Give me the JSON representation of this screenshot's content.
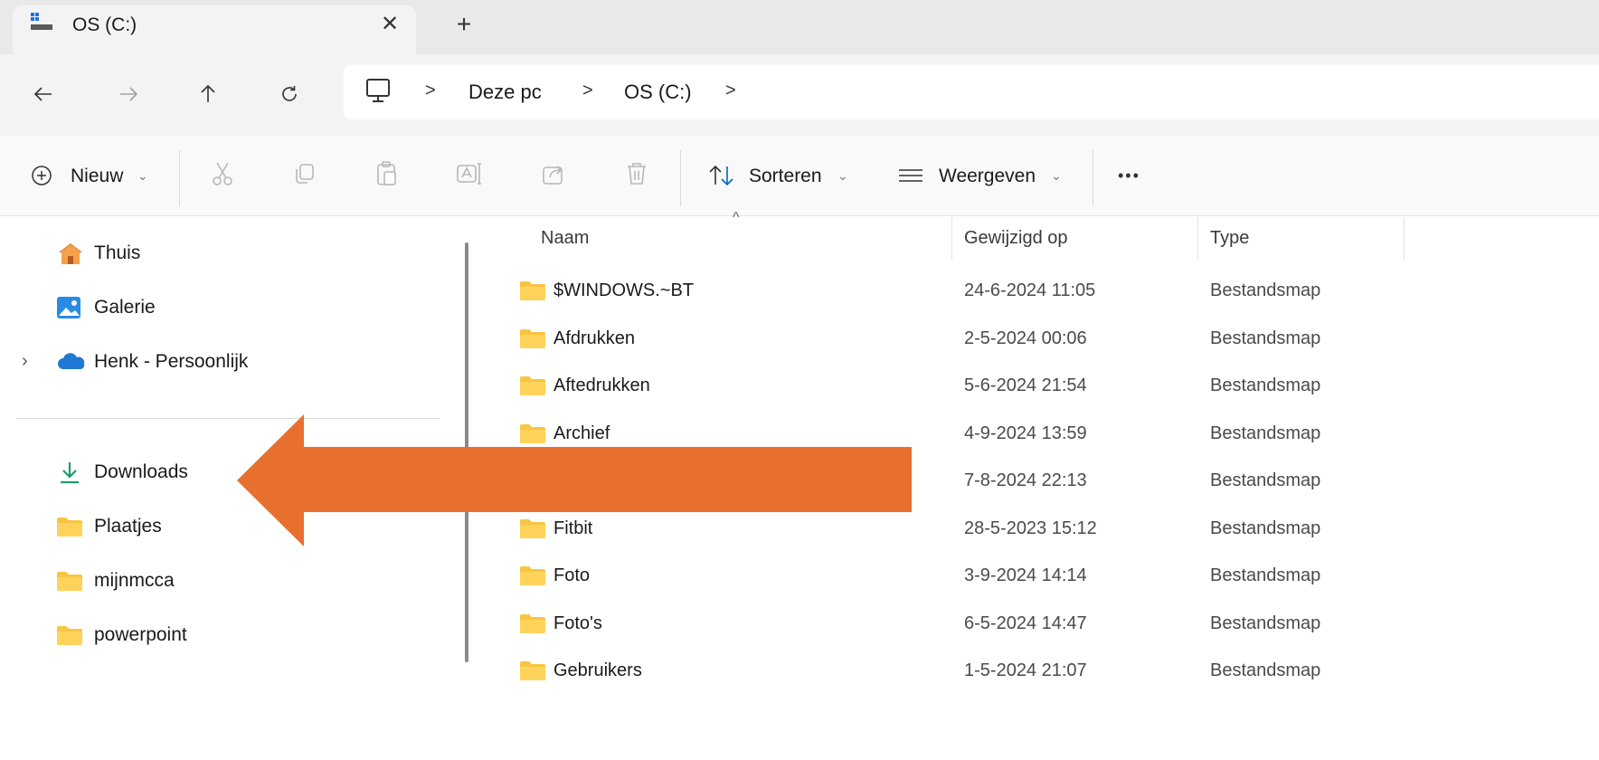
{
  "tab": {
    "title": "OS (C:)",
    "close_glyph": "✕",
    "add_glyph": "+"
  },
  "nav": {
    "back_icon": "arrow-left-icon",
    "forward_icon": "arrow-right-icon",
    "up_icon": "arrow-up-icon",
    "refresh_icon": "refresh-icon",
    "breadcrumb": [
      "Deze pc",
      "OS (C:)"
    ]
  },
  "toolbar": {
    "new_label": "Nieuw",
    "sort_label": "Sorteren",
    "view_label": "Weergeven",
    "more_glyph": "•••"
  },
  "sidebar": {
    "items_top": [
      {
        "label": "Thuis",
        "icon": "home-icon"
      },
      {
        "label": "Galerie",
        "icon": "gallery-icon"
      },
      {
        "label": "Henk - Persoonlijk",
        "icon": "onedrive-icon"
      }
    ],
    "items_quick": [
      {
        "label": "Downloads",
        "icon": "download-icon"
      },
      {
        "label": "Plaatjes",
        "icon": "folder-icon"
      },
      {
        "label": "mijnmcca",
        "icon": "folder-icon"
      },
      {
        "label": "powerpoint",
        "icon": "folder-icon"
      }
    ]
  },
  "filelist": {
    "columns": [
      "Naam",
      "Gewijzigd op",
      "Type"
    ],
    "rows": [
      {
        "name": "$WINDOWS.~BT",
        "date": "24-6-2024 11:05",
        "type": "Bestandsmap"
      },
      {
        "name": "Afdrukken",
        "date": "2-5-2024 00:06",
        "type": "Bestandsmap"
      },
      {
        "name": "Aftedrukken",
        "date": "5-6-2024 21:54",
        "type": "Bestandsmap"
      },
      {
        "name": "Archief",
        "date": "4-9-2024 13:59",
        "type": "Bestandsmap"
      },
      {
        "name": "",
        "date": "7-8-2024 22:13",
        "type": "Bestandsmap"
      },
      {
        "name": "Fitbit",
        "date": "28-5-2023 15:12",
        "type": "Bestandsmap"
      },
      {
        "name": "Foto",
        "date": "3-9-2024 14:14",
        "type": "Bestandsmap"
      },
      {
        "name": "Foto's",
        "date": "6-5-2024 14:47",
        "type": "Bestandsmap"
      },
      {
        "name": "Gebruikers",
        "date": "1-5-2024 21:07",
        "type": "Bestandsmap"
      }
    ]
  },
  "colors": {
    "annotation_arrow": "#E8702F",
    "folder": "#F7C544",
    "accent": "#0067C0"
  }
}
